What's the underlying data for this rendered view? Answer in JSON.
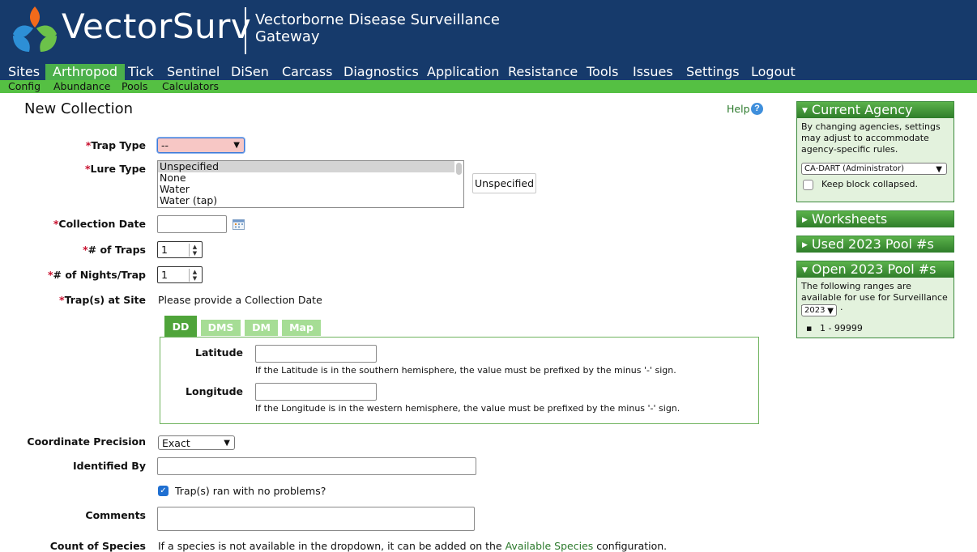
{
  "header": {
    "logo_text": "VectorSurv",
    "gateway_line1": "Vectorborne Disease Surveillance",
    "gateway_line2": "Gateway"
  },
  "nav": [
    {
      "label": "Sites"
    },
    {
      "label": "Arthropod"
    },
    {
      "label": "Tick"
    },
    {
      "label": "Sentinel"
    },
    {
      "label": "DiSen"
    },
    {
      "label": "Carcass"
    },
    {
      "label": "Diagnostics"
    },
    {
      "label": "Application"
    },
    {
      "label": "Resistance"
    },
    {
      "label": "Tools"
    },
    {
      "label": "Issues"
    },
    {
      "label": "Settings"
    },
    {
      "label": "Logout"
    }
  ],
  "subnav": [
    {
      "label": "Config"
    },
    {
      "label": "Abundance"
    },
    {
      "label": "Pools"
    },
    {
      "label": "Calculators"
    }
  ],
  "page": {
    "title": "New Collection",
    "help": "Help",
    "help_icon": "?"
  },
  "form": {
    "required_mark": "*",
    "trap_type": {
      "label": "Trap Type",
      "value": "--"
    },
    "lure_type": {
      "label": "Lure Type",
      "options": [
        "Unspecified",
        "None",
        "Water",
        "Water (tap)"
      ],
      "selected_display": "Unspecified"
    },
    "collection_date": {
      "label": "Collection Date",
      "value": ""
    },
    "num_traps": {
      "label": "# of Traps",
      "value": "1"
    },
    "num_nights": {
      "label": "# of Nights/Trap",
      "value": "1"
    },
    "traps_at_site": {
      "label": "Trap(s) at Site",
      "message": "Please provide a Collection Date"
    },
    "coord_tabs": [
      {
        "label": "DD"
      },
      {
        "label": "DMS"
      },
      {
        "label": "DM"
      },
      {
        "label": "Map"
      }
    ],
    "latitude": {
      "label": "Latitude",
      "value": "",
      "hint": "If the Latitude is in the southern hemisphere, the value must be prefixed by the minus '-' sign."
    },
    "longitude": {
      "label": "Longitude",
      "value": "",
      "hint": "If the Longitude is in the western hemisphere, the value must be prefixed by the minus '-' sign."
    },
    "coordinate_precision": {
      "label": "Coordinate Precision",
      "value": "Exact"
    },
    "identified_by": {
      "label": "Identified By",
      "value": ""
    },
    "trap_ok": {
      "label": "Trap(s) ran with no problems?",
      "checked": true
    },
    "comments": {
      "label": "Comments",
      "value": ""
    },
    "count_species": {
      "label": "Count of Species",
      "text_before": "If a species is not available in the dropdown, it can be added on the",
      "link": "Available Species",
      "text_after": "configuration."
    }
  },
  "sidebar": {
    "current_agency": {
      "title": "Current Agency",
      "desc": "By changing agencies, settings may adjust to accommodate agency-specific rules.",
      "agency": "CA-DART (Administrator)",
      "keep_collapsed": "Keep block collapsed."
    },
    "worksheets": {
      "title": "Worksheets"
    },
    "used_pools": {
      "title": "Used 2023 Pool #s"
    },
    "open_pools": {
      "title": "Open 2023 Pool #s",
      "desc": "The following ranges are available for use for Surveillance Year:",
      "year": "2023",
      "range": "1 - 99999"
    }
  },
  "icons": {
    "calendar": "calendar-icon",
    "help": "help-icon",
    "checkbox": "check-icon"
  }
}
